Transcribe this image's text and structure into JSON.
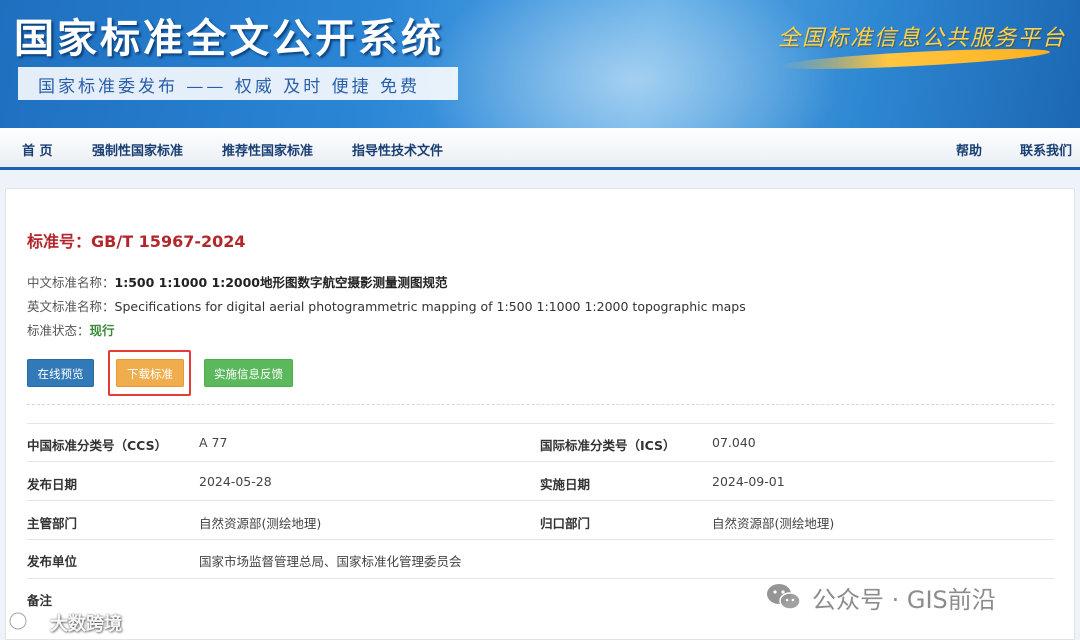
{
  "header": {
    "site_title": "国家标准全文公开系统",
    "slogan": "国家标准委发布 —— 权威 及时 便捷 免费",
    "platform_name": "全国标准信息公共服务平台"
  },
  "nav": {
    "items": [
      {
        "label": "首 页"
      },
      {
        "label": "强制性国家标准"
      },
      {
        "label": "推荐性国家标准"
      },
      {
        "label": "指导性技术文件"
      }
    ],
    "help": "帮助",
    "contact": "联系我们"
  },
  "standard": {
    "number_label": "标准号：",
    "number": "GB/T 15967-2024",
    "cn_name_label": "中文标准名称：",
    "cn_name": "1:500 1:1000 1:2000地形图数字航空摄影测量测图规范",
    "en_name_label": "英文标准名称：",
    "en_name": "Specifications for digital aerial photogrammetric mapping of 1:500 1:1000 1:2000 topographic maps",
    "status_label": "标准状态：",
    "status": "现行"
  },
  "actions": {
    "preview": "在线预览",
    "download": "下载标准",
    "feedback": "实施信息反馈"
  },
  "details": [
    {
      "label1": "中国标准分类号（CCS）",
      "value1": "A 77",
      "label2": "国际标准分类号（ICS）",
      "value2": "07.040"
    },
    {
      "label1": "发布日期",
      "value1": "2024-05-28",
      "label2": "实施日期",
      "value2": "2024-09-01"
    },
    {
      "label1": "主管部门",
      "value1": "自然资源部(测绘地理)",
      "label2": "归口部门",
      "value2": "自然资源部(测绘地理)"
    },
    {
      "label1": "发布单位",
      "value1": "国家市场监督管理总局、国家标准化管理委员会",
      "label2": "",
      "value2": ""
    },
    {
      "label1": "备注",
      "value1": "",
      "label2": "",
      "value2": ""
    }
  ],
  "watermarks": {
    "left": "大数跨境",
    "right": "公众号 · GIS前沿"
  },
  "colors": {
    "banner_blue": "#2b86d6",
    "title_red": "#b3262b",
    "preview_btn": "#3279b7",
    "download_btn": "#f0ad4e",
    "feedback_btn": "#5cb85c",
    "highlight": "#e53a36",
    "status_green": "#3a8a3a"
  }
}
